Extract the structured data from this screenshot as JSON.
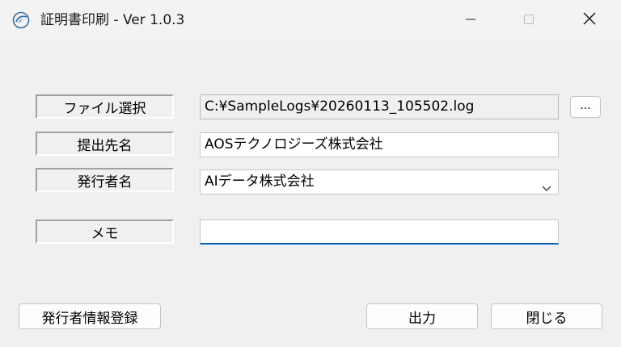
{
  "window": {
    "title": "証明書印刷 - Ver 1.0.3",
    "icon": "app-icon",
    "controls": {
      "minimize_icon": "minimize-icon",
      "maximize_icon": "maximize-icon",
      "close_icon": "close-icon"
    }
  },
  "form": {
    "file_select": {
      "label": "ファイル選択",
      "value": "C:¥SampleLogs¥20260113_105502.log",
      "browse_label": "..."
    },
    "recipient": {
      "label": "提出先名",
      "value": "AOSテクノロジーズ株式会社"
    },
    "issuer": {
      "label": "発行者名",
      "selected": "AIデータ株式会社"
    },
    "memo": {
      "label": "メモ",
      "value": ""
    }
  },
  "buttons": {
    "register_issuer": "発行者情報登録",
    "output": "出力",
    "close": "閉じる"
  },
  "colors": {
    "window_bg": "#f0f0f0",
    "focus_accent": "#005fb8"
  }
}
